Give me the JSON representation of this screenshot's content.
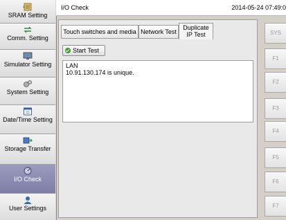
{
  "sidebar": {
    "items": [
      {
        "label": "SRAM Setting",
        "icon": "sram-icon"
      },
      {
        "label": "Comm. Setting",
        "icon": "comm-arrows-icon"
      },
      {
        "label": "Simulator Setting",
        "icon": "monitor-icon"
      },
      {
        "label": "System Setting",
        "icon": "gears-icon"
      },
      {
        "label": "Date/Time Setting",
        "icon": "calendar-icon"
      },
      {
        "label": "Storage Transfer",
        "icon": "storage-icon"
      },
      {
        "label": "I/O Check",
        "icon": "io-check-icon"
      },
      {
        "label": "User Settings",
        "icon": "user-icon"
      }
    ]
  },
  "header": {
    "title": "I/O Check",
    "datetime": "2014-05-24 07:49:0"
  },
  "tabs": [
    {
      "label": "Touch switches and media"
    },
    {
      "label": "Network Test"
    },
    {
      "label": "Duplicate IP Test"
    }
  ],
  "start_button": {
    "label": "Start Test"
  },
  "result": {
    "line1": "LAN",
    "line2": "10.91.130.174 is unique."
  },
  "function_keys": [
    "SYS",
    "F1",
    "F2",
    "F3",
    "F4",
    "F5",
    "F6",
    "F7"
  ],
  "colors": {
    "active_sidebar": "#8a8ab0",
    "ok_green": "#3c9c2c"
  }
}
